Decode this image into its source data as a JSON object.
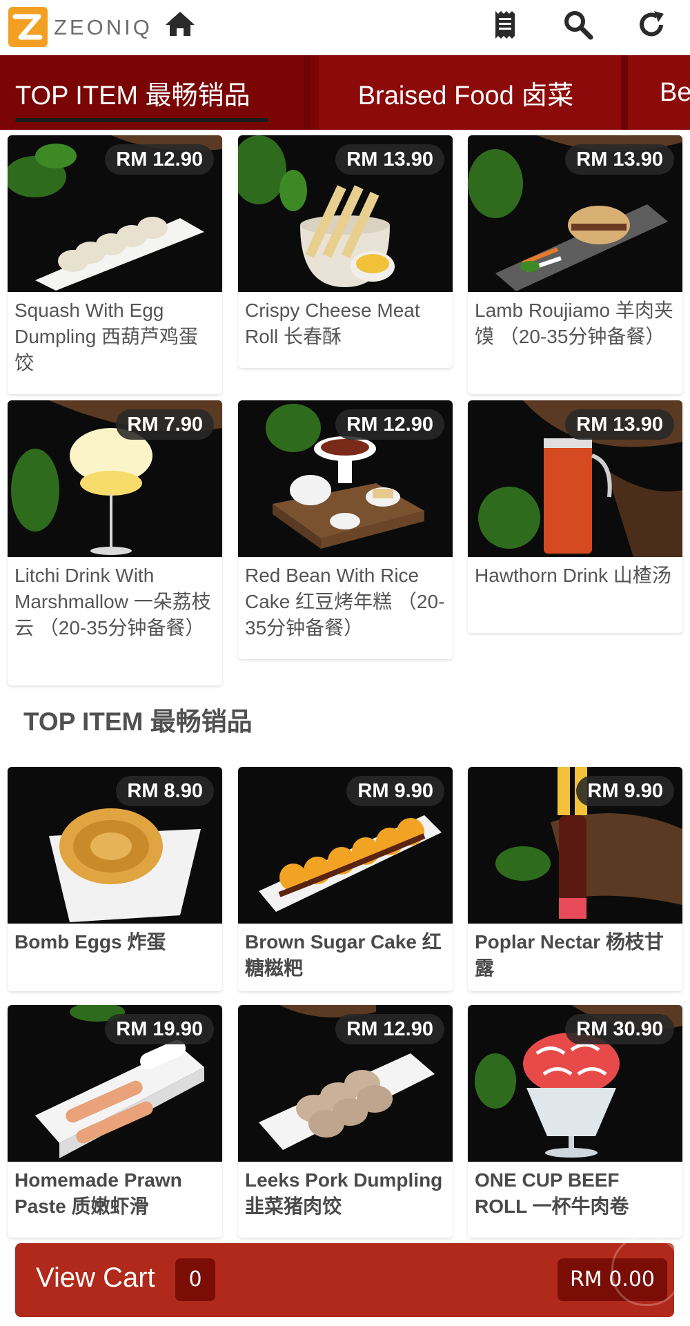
{
  "header": {
    "brand": "ZEONIQ",
    "icons": [
      "home-icon",
      "receipt-icon",
      "search-icon",
      "refresh-icon"
    ]
  },
  "tabs": [
    {
      "label": "TOP ITEM 最畅销品",
      "active": true
    },
    {
      "label": "Braised Food 卤菜",
      "active": false
    },
    {
      "label": "Be",
      "active": false
    }
  ],
  "top_items": [
    {
      "price": "RM 12.90",
      "name": "Squash With Egg Dumpling 西葫芦鸡蛋饺"
    },
    {
      "price": "RM 13.90",
      "name": "Crispy Cheese Meat Roll 长春酥"
    },
    {
      "price": "RM 13.90",
      "name": "Lamb Roujiamo 羊肉夹馍 （20-35分钟备餐）"
    },
    {
      "price": "RM 7.90",
      "name": "Litchi Drink With Marshmallow 一朵荔枝云 （20-35分钟备餐）"
    },
    {
      "price": "RM 12.90",
      "name": "Red Bean With Rice Cake 红豆烤年糕 （20-35分钟备餐）"
    },
    {
      "price": "RM 13.90",
      "name": "Hawthorn Drink 山楂汤"
    }
  ],
  "section": {
    "title": "TOP ITEM 最畅销品",
    "items": [
      {
        "price": "RM 8.90",
        "name": "Bomb Eggs 炸蛋"
      },
      {
        "price": "RM 9.90",
        "name": "Brown Sugar Cake 红糖糍粑"
      },
      {
        "price": "RM 9.90",
        "name": "Poplar Nectar 杨枝甘露"
      },
      {
        "price": "RM 19.90",
        "name": "Homemade Prawn Paste 质嫩虾滑"
      },
      {
        "price": "RM 12.90",
        "name": "Leeks Pork Dumpling韭菜猪肉饺"
      },
      {
        "price": "RM 30.90",
        "name": "ONE CUP BEEF ROLL 一杯牛肉卷"
      }
    ]
  },
  "cart": {
    "label": "View Cart",
    "count": "0",
    "total": "RM 0.00"
  },
  "colors": {
    "tab_bar": "#8c0a0a",
    "cart_bar": "#b0291a",
    "logo": "#f2a023"
  }
}
